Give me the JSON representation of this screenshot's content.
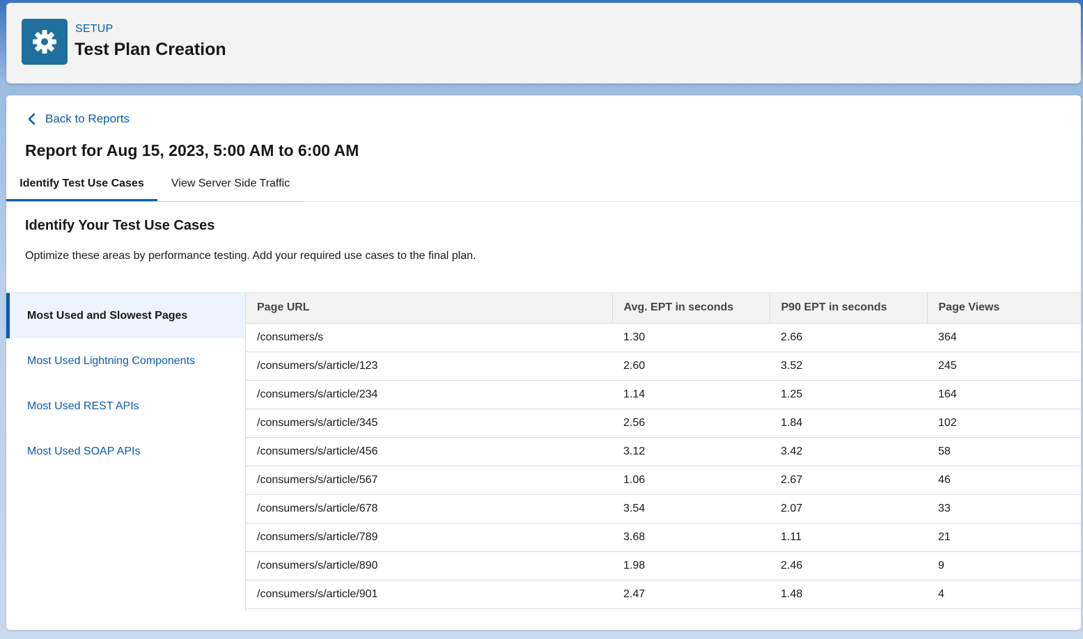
{
  "header": {
    "setup_label": "SETUP",
    "title": "Test Plan Creation",
    "icon": "gear-icon"
  },
  "back_link": {
    "label": "Back to Reports",
    "icon": "chevron-left-icon"
  },
  "report_title": "Report for Aug 15, 2023, 5:00 AM to 6:00 AM",
  "tabs": [
    {
      "label": "Identify Test Use Cases",
      "active": true
    },
    {
      "label": "View Server Side Traffic",
      "active": false
    }
  ],
  "section": {
    "heading": "Identify Your Test Use Cases",
    "description": "Optimize these areas by performance testing. Add your required use cases to the final plan."
  },
  "side_nav": [
    {
      "label": "Most Used and Slowest Pages",
      "active": true
    },
    {
      "label": "Most Used Lightning Components",
      "active": false
    },
    {
      "label": "Most Used REST APIs",
      "active": false
    },
    {
      "label": "Most Used SOAP APIs",
      "active": false
    }
  ],
  "table": {
    "columns": [
      "Page URL",
      "Avg. EPT in seconds",
      "P90 EPT in seconds",
      "Page Views"
    ],
    "rows": [
      [
        "/consumers/s",
        "1.30",
        "2.66",
        "364"
      ],
      [
        "/consumers/s/article/123",
        "2.60",
        "3.52",
        "245"
      ],
      [
        "/consumers/s/article/234",
        "1.14",
        "1.25",
        "164"
      ],
      [
        "/consumers/s/article/345",
        "2.56",
        "1.84",
        "102"
      ],
      [
        "/consumers/s/article/456",
        "3.12",
        "3.42",
        "58"
      ],
      [
        "/consumers/s/article/567",
        "1.06",
        "2.67",
        "46"
      ],
      [
        "/consumers/s/article/678",
        "3.54",
        "2.07",
        "33"
      ],
      [
        "/consumers/s/article/789",
        "3.68",
        "1.11",
        "21"
      ],
      [
        "/consumers/s/article/890",
        "1.98",
        "2.46",
        "9"
      ],
      [
        "/consumers/s/article/901",
        "2.47",
        "1.48",
        "4"
      ]
    ]
  },
  "colors": {
    "accent": "#0b5cab",
    "app_icon_bg": "#1f6f9f",
    "nav_active_bg": "#eef4ff"
  }
}
